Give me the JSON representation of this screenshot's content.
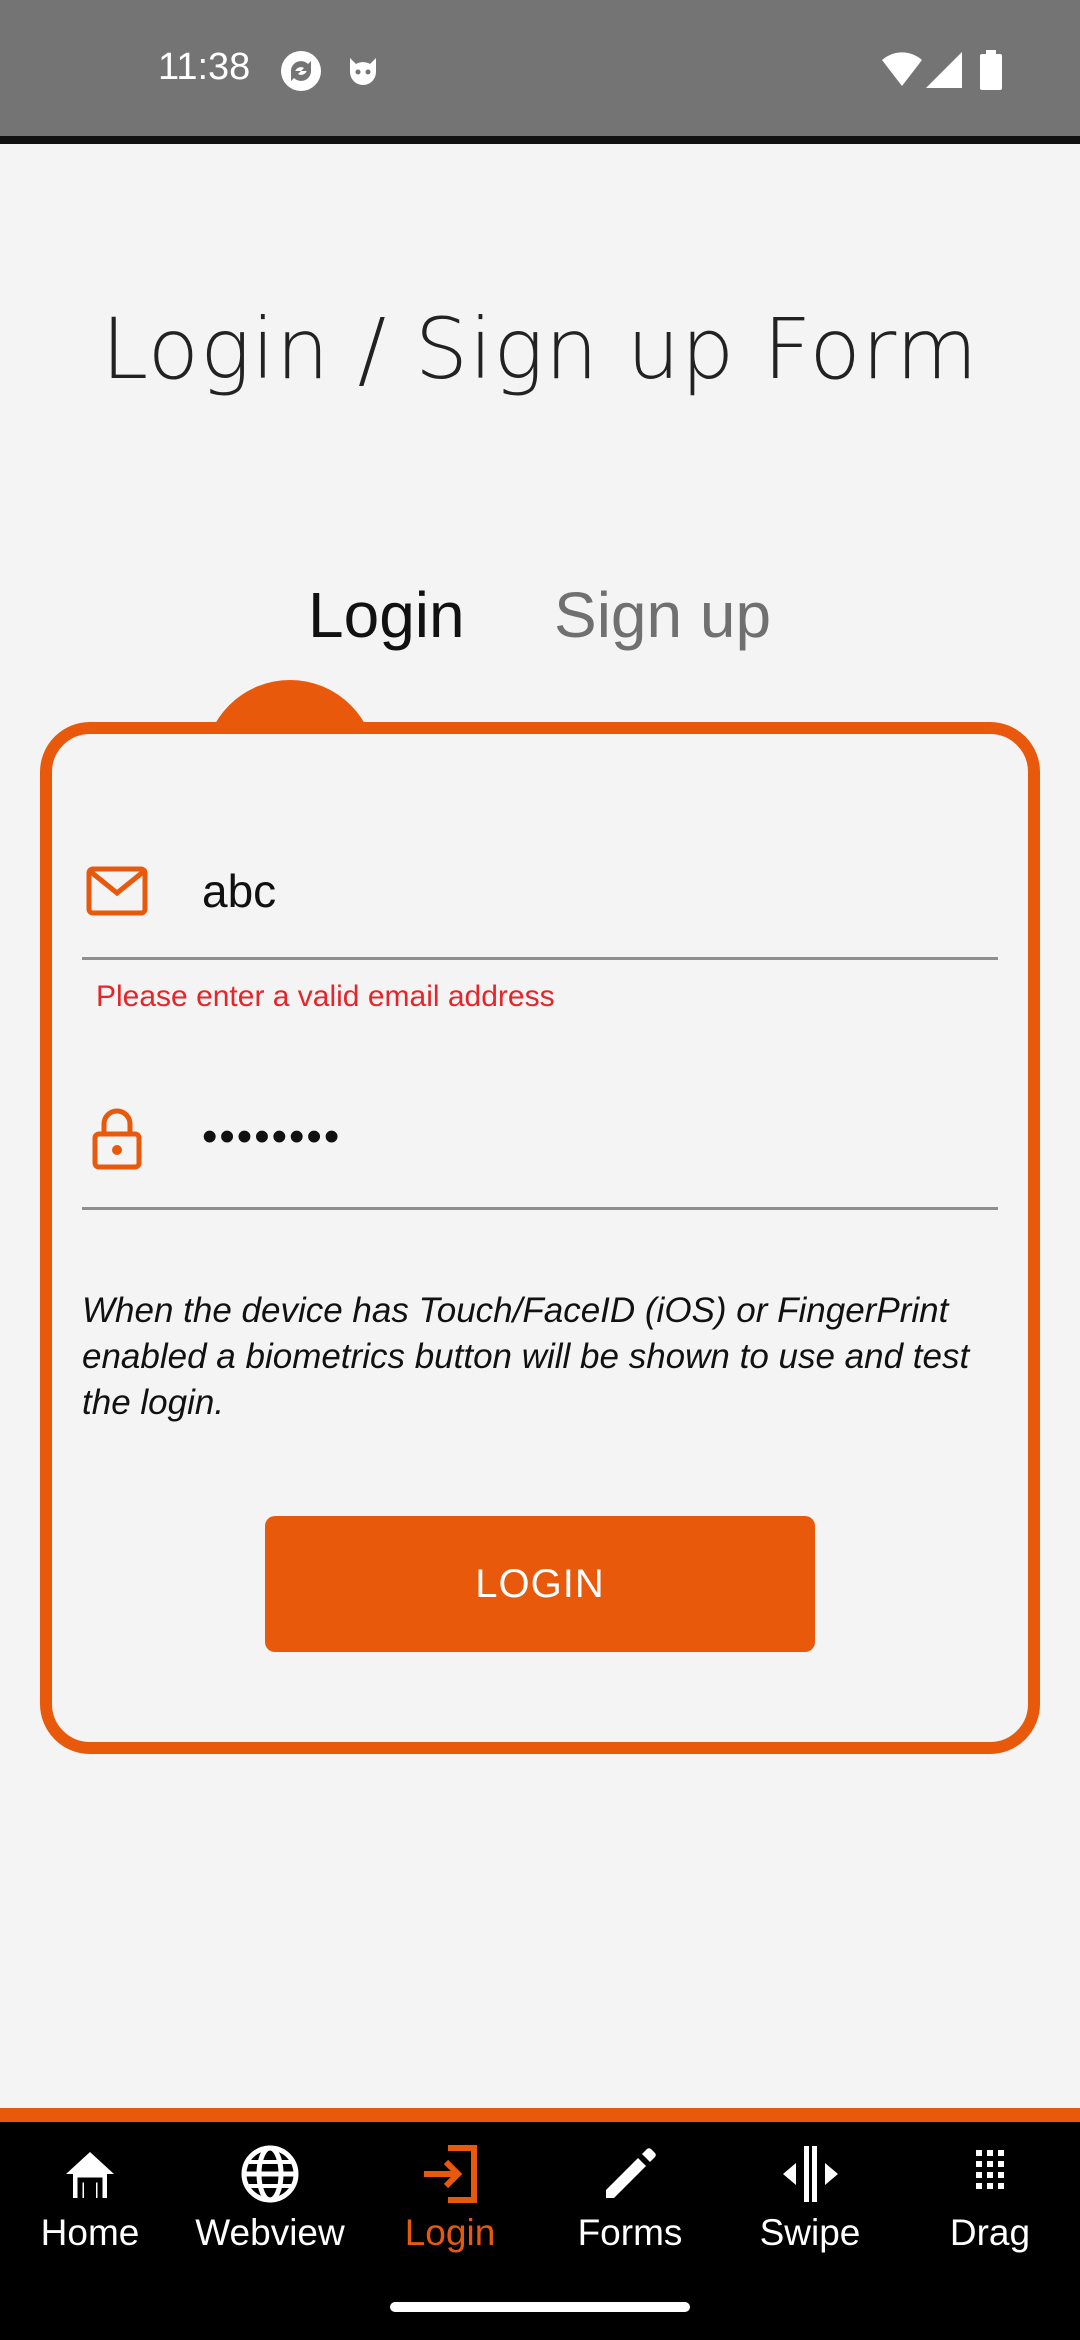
{
  "status_bar": {
    "time": "11:38",
    "left_icons": [
      "sync-icon",
      "cat-face-icon"
    ],
    "right_icons": [
      "wifi-icon",
      "cellular-icon",
      "battery-icon"
    ]
  },
  "title": "Login / Sign up Form",
  "tabs": {
    "login_label": "Login",
    "signup_label": "Sign up",
    "active": "Login"
  },
  "form": {
    "email": {
      "icon": "email-icon",
      "value": "abc",
      "error": "Please enter a valid email address"
    },
    "password": {
      "icon": "lock-icon",
      "value": "••••••••"
    },
    "info_text": "When the device has Touch/FaceID (iOS) or FingerPrint enabled a biometrics button will be shown to use and test the login.",
    "login_button": "LOGIN"
  },
  "bottom_nav": {
    "active": "Login",
    "items": [
      {
        "label": "Home",
        "icon": "home-icon"
      },
      {
        "label": "Webview",
        "icon": "globe-icon"
      },
      {
        "label": "Login",
        "icon": "login-icon"
      },
      {
        "label": "Forms",
        "icon": "pencil-icon"
      },
      {
        "label": "Swipe",
        "icon": "swipe-icon"
      },
      {
        "label": "Drag",
        "icon": "grid-dots-icon"
      }
    ]
  },
  "colors": {
    "accent": "#e8590c",
    "error": "#e5252a",
    "background": "#f4f4f4",
    "status_bar": "#747474",
    "nav_background": "#000000"
  }
}
